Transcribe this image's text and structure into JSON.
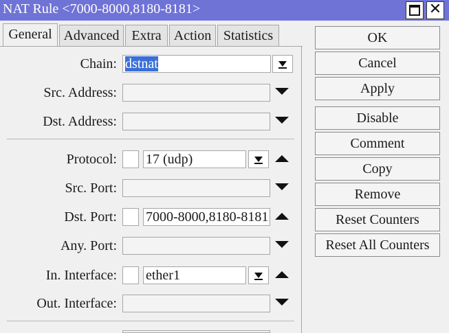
{
  "window": {
    "title": "NAT Rule <7000-8000,8180-8181>"
  },
  "tabs": [
    {
      "label": "General"
    },
    {
      "label": "Advanced"
    },
    {
      "label": "Extra"
    },
    {
      "label": "Action"
    },
    {
      "label": "Statistics"
    }
  ],
  "form": {
    "chain": {
      "label": "Chain:",
      "value": "dstnat"
    },
    "src_address": {
      "label": "Src. Address:",
      "value": ""
    },
    "dst_address": {
      "label": "Dst. Address:",
      "value": ""
    },
    "protocol": {
      "label": "Protocol:",
      "value": "17 (udp)"
    },
    "src_port": {
      "label": "Src. Port:",
      "value": ""
    },
    "dst_port": {
      "label": "Dst. Port:",
      "value": "7000-8000,8180-8181"
    },
    "any_port": {
      "label": "Any. Port:",
      "value": ""
    },
    "in_interface": {
      "label": "In. Interface:",
      "value": "ether1"
    },
    "out_interface": {
      "label": "Out. Interface:",
      "value": ""
    }
  },
  "buttons": {
    "ok": "OK",
    "cancel": "Cancel",
    "apply": "Apply",
    "disable": "Disable",
    "comment": "Comment",
    "copy": "Copy",
    "remove": "Remove",
    "reset_counters": "Reset Counters",
    "reset_all_counters": "Reset All Counters"
  },
  "colors": {
    "titlebar": "#6f73d6",
    "selection": "#3a6fd8",
    "background": "#f0f0f0"
  }
}
